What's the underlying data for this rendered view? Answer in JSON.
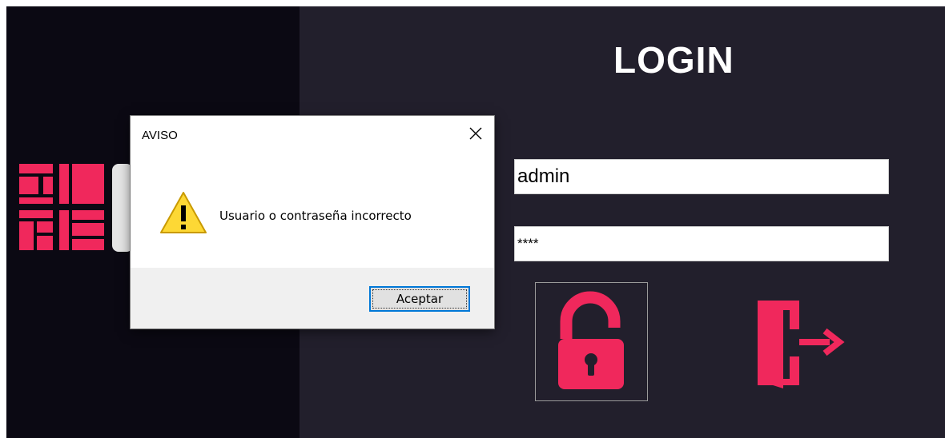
{
  "login": {
    "title": "LOGIN",
    "username_value": "admin",
    "password_value": "****"
  },
  "dialog": {
    "title": "AVISO",
    "message": "Usuario o contraseña incorrecto",
    "ok_label": "Aceptar",
    "icon": "warning-icon"
  },
  "icons": {
    "login": "unlock-icon",
    "exit": "exit-door-icon",
    "close": "close-icon"
  },
  "colors": {
    "left_panel": "#0b0913",
    "right_panel": "#221f2c",
    "accent": "#f0285c",
    "warning": "#fdd835",
    "focus": "#0078d7"
  }
}
